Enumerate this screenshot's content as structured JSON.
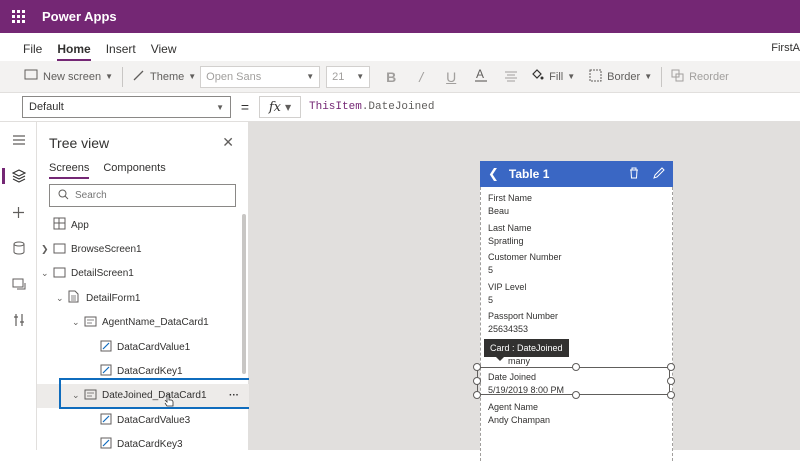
{
  "app": {
    "name": "Power Apps"
  },
  "menu": {
    "items": [
      "File",
      "Home",
      "Insert",
      "View"
    ],
    "active": "Home",
    "right_text": "FirstA"
  },
  "toolbar": {
    "new_screen": "New screen",
    "theme": "Theme",
    "font": "Open Sans",
    "font_size": "21",
    "fill": "Fill",
    "border": "Border",
    "reorder": "Reorder"
  },
  "formula": {
    "property": "Default",
    "equals": "=",
    "fx": "fx",
    "object": "ThisItem",
    "rest": ".DateJoined"
  },
  "tree": {
    "title": "Tree view",
    "tabs": [
      "Screens",
      "Components"
    ],
    "search_placeholder": "Search",
    "nodes": [
      {
        "label": "App",
        "depth": 0,
        "icon": "app-icon",
        "chevron": ""
      },
      {
        "label": "BrowseScreen1",
        "depth": 0,
        "icon": "screen-icon",
        "chevron": "right"
      },
      {
        "label": "DetailScreen1",
        "depth": 0,
        "icon": "screen-icon",
        "chevron": "down"
      },
      {
        "label": "DetailForm1",
        "depth": 1,
        "icon": "form-icon",
        "chevron": "down"
      },
      {
        "label": "AgentName_DataCard1",
        "depth": 2,
        "icon": "card-icon",
        "chevron": "down"
      },
      {
        "label": "DataCardValue1",
        "depth": 3,
        "icon": "edit-icon",
        "chevron": ""
      },
      {
        "label": "DataCardKey1",
        "depth": 3,
        "icon": "edit-icon",
        "chevron": ""
      },
      {
        "label": "DateJoined_DataCard1",
        "depth": 2,
        "icon": "card-icon",
        "chevron": "down",
        "selected": true
      },
      {
        "label": "DataCardValue3",
        "depth": 3,
        "icon": "edit-icon",
        "chevron": ""
      },
      {
        "label": "DataCardKey3",
        "depth": 3,
        "icon": "edit-icon",
        "chevron": ""
      }
    ],
    "more": "···"
  },
  "device": {
    "title": "Table 1",
    "fields": [
      {
        "label": "First Name",
        "value": "Beau"
      },
      {
        "label": "Last Name",
        "value": "Spratling"
      },
      {
        "label": "Customer Number",
        "value": "5"
      },
      {
        "label": "VIP Level",
        "value": "5"
      },
      {
        "label": "Passport Number",
        "value": "25634353"
      },
      {
        "label": "",
        "value": "many"
      },
      {
        "label": "Date Joined",
        "value": "5/19/2019 8:00 PM"
      },
      {
        "label": "Agent Name",
        "value": "Andy Champan"
      }
    ],
    "tooltip": "Card : DateJoined"
  },
  "colors": {
    "brand": "#742774",
    "header": "#3a67c4",
    "selection": "#0f6cbd"
  }
}
